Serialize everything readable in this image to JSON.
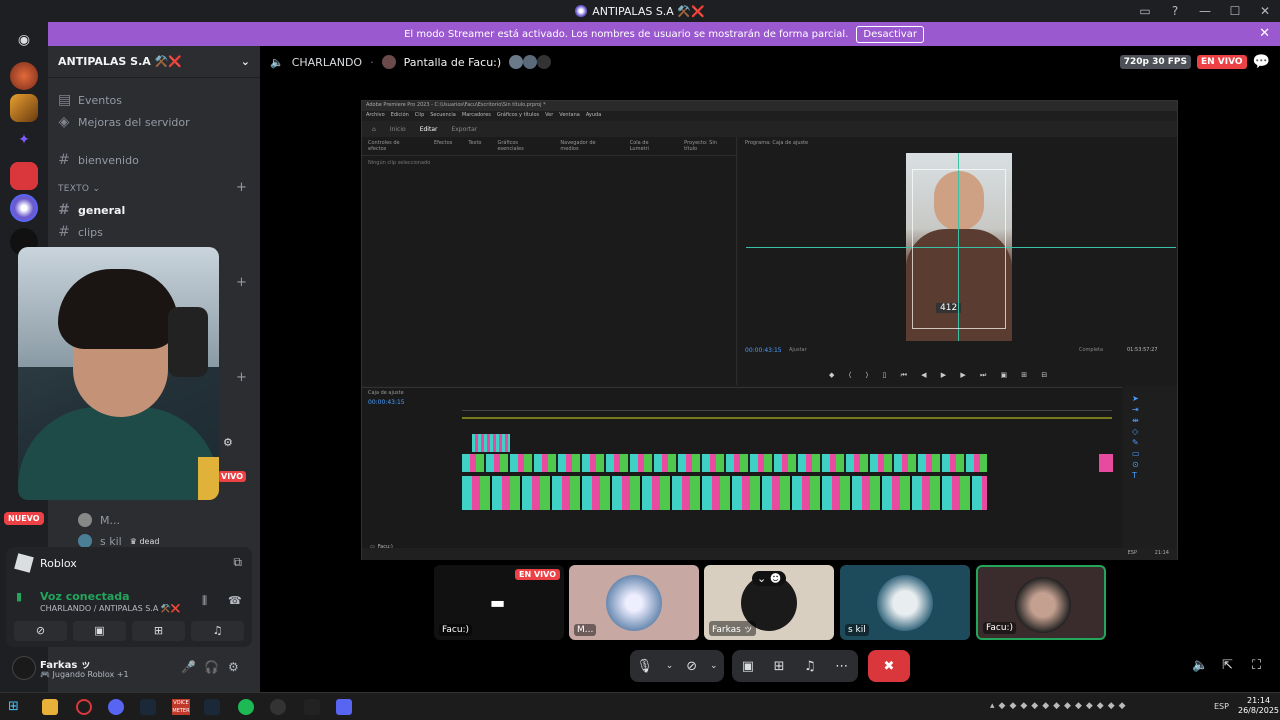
{
  "window": {
    "title": "ANTIPALAS S.A ⚒️❌"
  },
  "streamer_banner": {
    "text": "El modo Streamer está activado. Los nombres de usuario se mostrarán de forma parcial.",
    "button": "Desactivar"
  },
  "server": {
    "name": "ANTIPALAS S.A ⚒️❌",
    "items": [
      {
        "label": "Eventos"
      },
      {
        "label": "Mejoras del servidor"
      }
    ],
    "channels_top": [
      {
        "label": "bienvenido"
      }
    ],
    "category": "TEXTO",
    "text_channels": [
      {
        "label": "general"
      },
      {
        "label": "clips"
      }
    ],
    "members": [
      {
        "label": "M..."
      },
      {
        "label": "s kil"
      }
    ],
    "member_status": "dead",
    "new_badge": "NUEVO",
    "live_badge": "VIVO"
  },
  "voice_panel": {
    "activity": "Roblox",
    "status": "Voz conectada",
    "channel": "CHARLANDO / ANTIPALAS S.A ⚒️❌"
  },
  "user": {
    "name": "Farkas ッ",
    "activity": "Jugando Roblox +1"
  },
  "stage": {
    "channel": "CHARLANDO",
    "separator": "·",
    "share_title": "Pantalla de Facu:)",
    "quality": "720p 30 FPS",
    "live": "EN VIVO"
  },
  "screen": {
    "title": "Adobe Premiere Pro 2023 - C:\\Usuarios\\Facu\\Escritorio\\Sin título.prproj *",
    "menu": [
      "Archivo",
      "Edición",
      "Clip",
      "Secuencia",
      "Marcadores",
      "Gráficos y títulos",
      "Ver",
      "Ventana",
      "Ayuda"
    ],
    "tabs": [
      "Inicio",
      "Editar",
      "Exportar"
    ],
    "left_panel_tabs": [
      "Controles de efectos",
      "Efectos",
      "Texto",
      "Gráficos esenciales",
      "Navegador de medios",
      "Cola de Lumetri",
      "Proyecto: Sin título"
    ],
    "no_clip": "Ningún clip seleccionado",
    "program_label": "Programa: Caja de ajuste",
    "timecode": "00:00:43:15",
    "fit": "Ajustar",
    "quality": "Completa",
    "duration": "01:53:57:27",
    "sequence": "Caja de ajuste",
    "timeline_timecode": "00:00:43:15",
    "caption_number": "412",
    "sharer_label": "Facu:)",
    "task_time": "21:14",
    "task_lang": "ESP"
  },
  "tiles": [
    {
      "name": "Facu:)",
      "live": "EN VIVO"
    },
    {
      "name": "M..."
    },
    {
      "name": "Farkas ッ"
    },
    {
      "name": "s kil"
    },
    {
      "name": "Facu:)"
    }
  ],
  "taskbar": {
    "time": "21:14",
    "date": "26/8/2025",
    "lang": "ESP",
    "voice_label": "VOICE METER"
  },
  "colors": {
    "banner": "#9b59d0",
    "live": "#ed4245",
    "connected": "#23a55a",
    "end_call": "#da373c",
    "accent": "#5865f2"
  }
}
